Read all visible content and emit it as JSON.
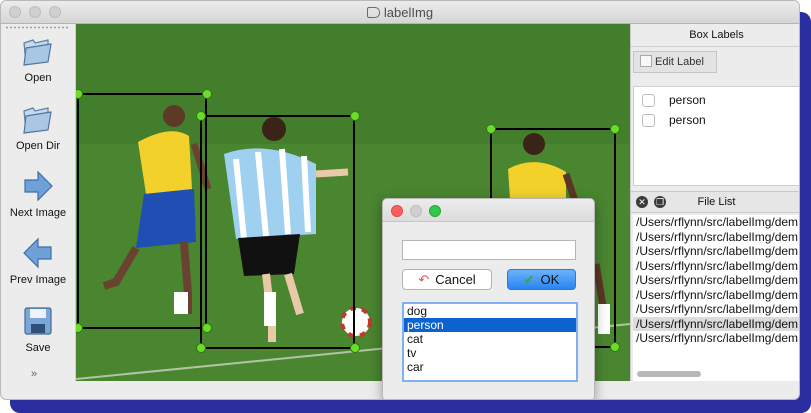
{
  "window": {
    "title": "labelImg"
  },
  "toolbar": {
    "open": "Open",
    "open_dir": "Open Dir",
    "next_image": "Next Image",
    "prev_image": "Prev Image",
    "save": "Save",
    "more": "»"
  },
  "box_labels": {
    "title": "Box Labels",
    "edit_label": "Edit Label",
    "items": [
      "person",
      "person"
    ]
  },
  "file_list": {
    "title": "File List",
    "files": [
      "/Users/rflynn/src/labelImg/dem",
      "/Users/rflynn/src/labelImg/dem",
      "/Users/rflynn/src/labelImg/dem",
      "/Users/rflynn/src/labelImg/dem",
      "/Users/rflynn/src/labelImg/dem",
      "/Users/rflynn/src/labelImg/dem",
      "/Users/rflynn/src/labelImg/dem",
      "/Users/rflynn/src/labelImg/dem",
      "/Users/rflynn/src/labelImg/dem"
    ],
    "selected_index": 7
  },
  "dialog": {
    "input_value": "",
    "cancel": "Cancel",
    "ok": "OK",
    "options": [
      "dog",
      "person",
      "cat",
      "tv",
      "car"
    ],
    "selected_option": "person"
  },
  "colors": {
    "shadow": "#2b2e9e",
    "box_border": "#000000",
    "vertex": "#6bdc2a",
    "list_selection": "#0b63d0",
    "ok_button": "#2a84f0"
  }
}
